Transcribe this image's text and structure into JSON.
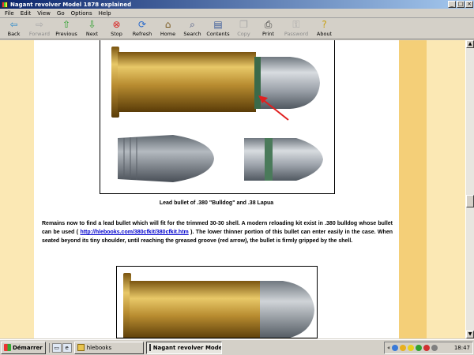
{
  "window": {
    "title": "Nagant revolver Model 1878 explained"
  },
  "menu": [
    "File",
    "Edit",
    "View",
    "Go",
    "Options",
    "Help"
  ],
  "toolbar": {
    "back": "Back",
    "forward": "Forward",
    "previous": "Previous",
    "next": "Next",
    "stop": "Stop",
    "refresh": "Refresh",
    "home": "Home",
    "search": "Search",
    "contents": "Contents",
    "copy": "Copy",
    "print": "Print",
    "password": "Password",
    "about": "About"
  },
  "content": {
    "caption": "Lead bullet of .380 \"Bulldog\" and .38 Lapua",
    "para_part1": "Remains now to find a lead bullet which will fit for the trimmed 30-30 shell. A modern reloading kit exist in .380 bulldog whose bullet can be used ( ",
    "link": "http://hlebooks.com/380cfkit/380cfkit.htm",
    "para_part2": " ). The lower thinner portion of this bullet can enter easily in the case. When seated beyond its tiny shoulder, until reaching the greased groove (red arrow), the bullet is firmly gripped by the shell."
  },
  "taskbar": {
    "start": "Démarrer",
    "task1": "hlebooks",
    "task2": "Nagant revolver Model...",
    "clock": "18:47",
    "tray_chevron": "«"
  },
  "colors": {
    "brass": "#c8a040",
    "lead": "#9aa0a8",
    "page_margin": "#fbe8b4",
    "sidebar_stripe": "#f4cf78",
    "link": "#0000cc"
  }
}
